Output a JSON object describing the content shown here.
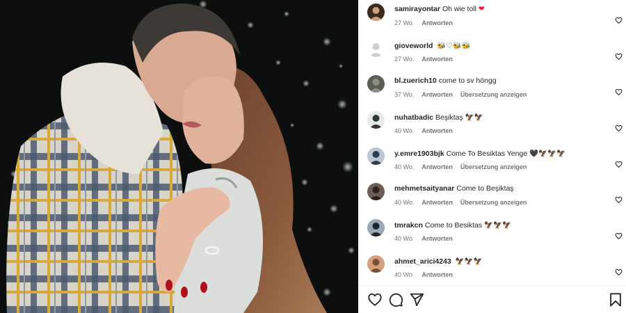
{
  "comments": [
    {
      "user": "samirayontar",
      "text": "Oh wie toll",
      "emoji": "❤",
      "emoji_color": "#ed1c24",
      "age": "27 Wo.",
      "reply": "Antworten",
      "translate": ""
    },
    {
      "user": "gioveworld",
      "text": "",
      "emoji": "🐝♡🐝🐝",
      "emoji_color": "#1a1a1a",
      "age": "27 Wo.",
      "reply": "Antworten",
      "translate": ""
    },
    {
      "user": "bl.zuerich10",
      "text": "come to sv höngg",
      "emoji": "",
      "emoji_color": "",
      "age": "37 Wo.",
      "reply": "Antworten",
      "translate": "Übersetzung anzeigen"
    },
    {
      "user": "nuhatbadic",
      "text": "Beşiktaş",
      "emoji": "🦅🦅",
      "emoji_color": "#1a1a1a",
      "age": "40 Wo.",
      "reply": "Antworten",
      "translate": ""
    },
    {
      "user": "y.emre1903bjk",
      "text": "Come To Besiktas Yenge",
      "emoji": "🖤🦅🦅🦅",
      "emoji_color": "#1a1a1a",
      "age": "40 Wo.",
      "reply": "Antworten",
      "translate": "Übersetzung anzeigen"
    },
    {
      "user": "mehmetsaityanar",
      "text": "Come to Beşiktaş",
      "emoji": "",
      "emoji_color": "",
      "age": "40 Wo.",
      "reply": "Antworten",
      "translate": "Übersetzung anzeigen"
    },
    {
      "user": "tmrakcn",
      "text": "Come to Besiktas",
      "emoji": "🦅🦅🦅",
      "emoji_color": "#1a1a1a",
      "age": "40 Wo.",
      "reply": "Antworten",
      "translate": ""
    },
    {
      "user": "ahmet_arici4243",
      "text": "",
      "emoji": "🦅🦅🦅",
      "emoji_color": "#1a1a1a",
      "age": "40 Wo.",
      "reply": "Antworten",
      "translate": ""
    }
  ],
  "avatars": [
    "samirayontar-avatar",
    "gioveworld-avatar",
    "bl.zuerich10-avatar",
    "nuhatbadic-avatar",
    "y.emre1903bjk-avatar",
    "mehmetsaityanar-avatar",
    "tmrakcn-avatar",
    "ahmet_arici4243-avatar"
  ],
  "actions": {
    "like_icon": "heart-icon",
    "comment_icon": "comment-bubble-icon",
    "share_icon": "paper-plane-icon",
    "save_icon": "bookmark-icon"
  },
  "colors": {
    "text": "#262626",
    "muted": "#737373",
    "heart_red": "#ed1c24"
  }
}
